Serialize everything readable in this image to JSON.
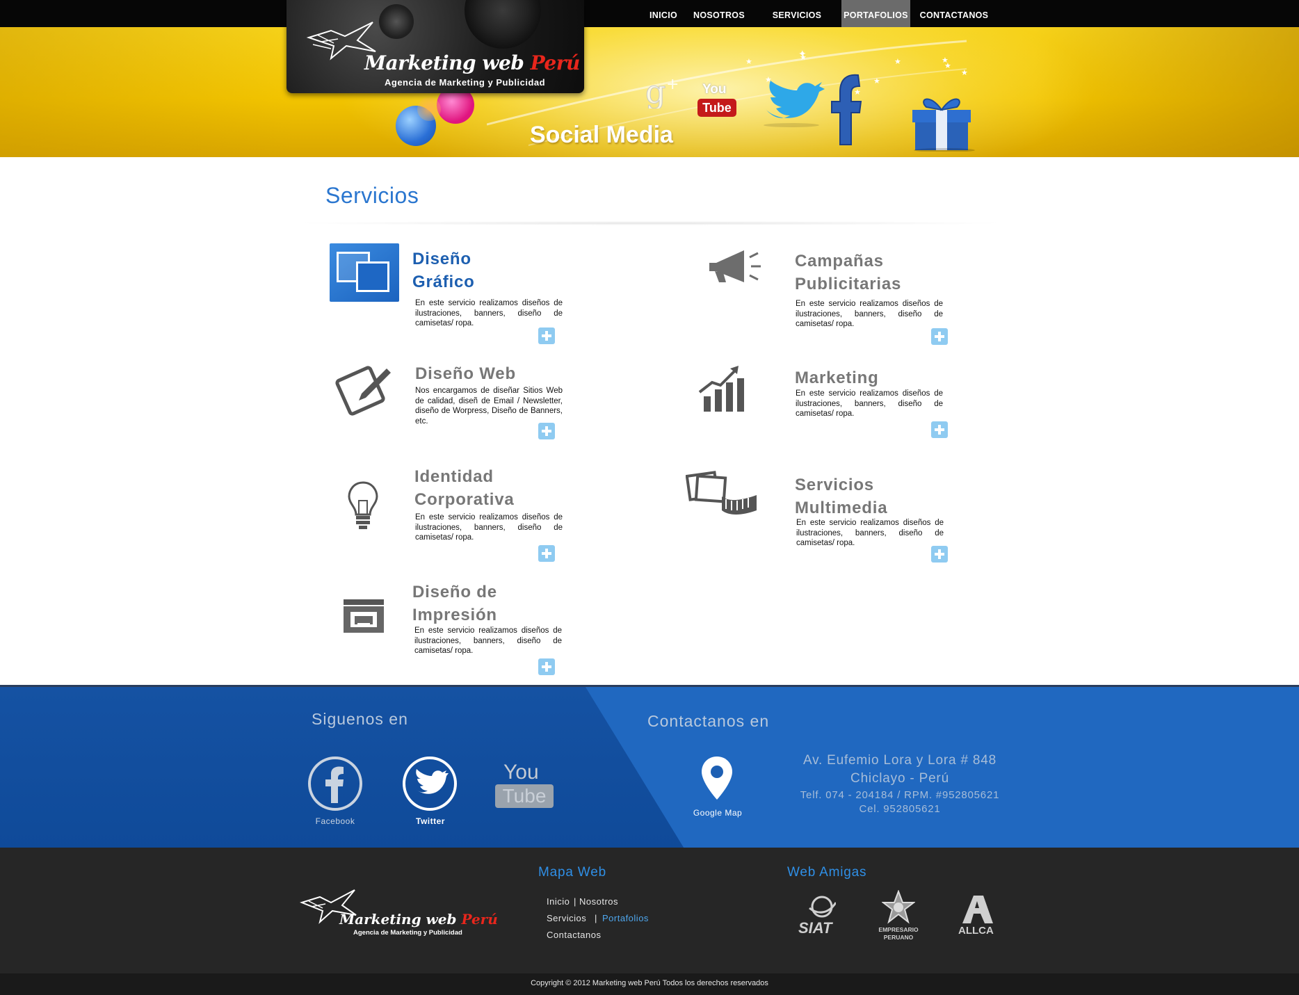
{
  "nav": {
    "items": [
      {
        "label": "INICIO"
      },
      {
        "label": "NOSOTROS"
      },
      {
        "label": "SERVICIOS"
      },
      {
        "label": "PORTAFOLIOS",
        "active": true
      },
      {
        "label": "CONTACTANOS"
      }
    ]
  },
  "brand": {
    "name_part1": "Marketing web ",
    "name_part2": "Perú",
    "tagline": "Agencia de Marketing y Publicidad"
  },
  "hero": {
    "title": "Social Media",
    "icons": [
      "google-plus-icon",
      "youtube-icon",
      "twitter-bird-icon",
      "facebook-icon",
      "gift-box-icon"
    ],
    "youtube_you": "You",
    "youtube_tube": "Tube"
  },
  "main": {
    "heading": "Servicios",
    "services": [
      {
        "title_line1": "Diseño",
        "title_line2": "Gráfico",
        "desc": "En este servicio realizamos diseños de ilustraciones, banners, diseño de camisetas/ ropa.",
        "icon": "windows-icon"
      },
      {
        "title_line1": "Campañas",
        "title_line2": "Publicitarias",
        "desc": "En este servicio realizamos diseños de ilustraciones, banners, diseño de camisetas/ ropa.",
        "icon": "megaphone-icon"
      },
      {
        "title_line1": "Diseño Web",
        "title_line2": "",
        "desc": "Nos encargamos de diseñar Sitios Web de calidad, diseñ de Email / Newsletter, diseño de Worpress, Diseño de Banners, etc.",
        "icon": "pen-tablet-icon"
      },
      {
        "title_line1": "Marketing",
        "title_line2": "",
        "desc": "En este servicio realizamos diseños de ilustraciones, banners, diseño de camisetas/ ropa.",
        "icon": "growth-chart-icon"
      },
      {
        "title_line1": "Identidad",
        "title_line2": "Corporativa",
        "desc": "En este servicio realizamos diseños de ilustraciones, banners, diseño de camisetas/ ropa.",
        "icon": "lightbulb-icon"
      },
      {
        "title_line1": "Servicios",
        "title_line2": "Multimedia",
        "desc": "En este servicio realizamos diseños de ilustraciones, banners, diseño de camisetas/ ropa.",
        "icon": "photos-film-icon"
      },
      {
        "title_line1": "Diseño de",
        "title_line2": "Impresión",
        "desc": "En este servicio realizamos diseños de ilustraciones, banners, diseño de camisetas/ ropa.",
        "icon": "printer-icon"
      }
    ]
  },
  "follow": {
    "heading": "Siguenos en",
    "items": [
      {
        "label": "Facebook",
        "icon": "facebook-icon"
      },
      {
        "label": "Twitter",
        "icon": "twitter-bird-icon"
      },
      {
        "you": "You",
        "tube": "Tube",
        "icon": "youtube-icon"
      }
    ]
  },
  "contact": {
    "heading": "Contactanos en",
    "map_label": "Google Map",
    "address_line1": "Av. Eufemio Lora y Lora # 848",
    "address_line2": "Chiclayo - Perú",
    "phone_line": "Telf. 074 - 204184 / RPM. #952805621",
    "cell_line": "Cel. 952805621"
  },
  "footer": {
    "site_map_heading": "Mapa Web",
    "links": {
      "inicio": "Inicio",
      "nosotros": "Nosotros",
      "servicios": "Servicios",
      "portafolios": "Portafolios",
      "contactanos": "Contactanos",
      "sep": "|"
    },
    "friends_heading": "Web Amigas",
    "partners": {
      "siat": "SIAT",
      "empresario_1": "EMPRESARIO",
      "empresario_2": "PERUANO",
      "allca": "ALLCA"
    },
    "copyright": "Copyright © 2012   Marketing web Perú Todos los derechos reservados"
  },
  "colors": {
    "accent_blue": "#2a76cf",
    "hero_yellow": "#f2c400",
    "band_blue": "#1d5fb3",
    "footer_dark": "#262626",
    "plus_button": "#8fcbf1"
  }
}
